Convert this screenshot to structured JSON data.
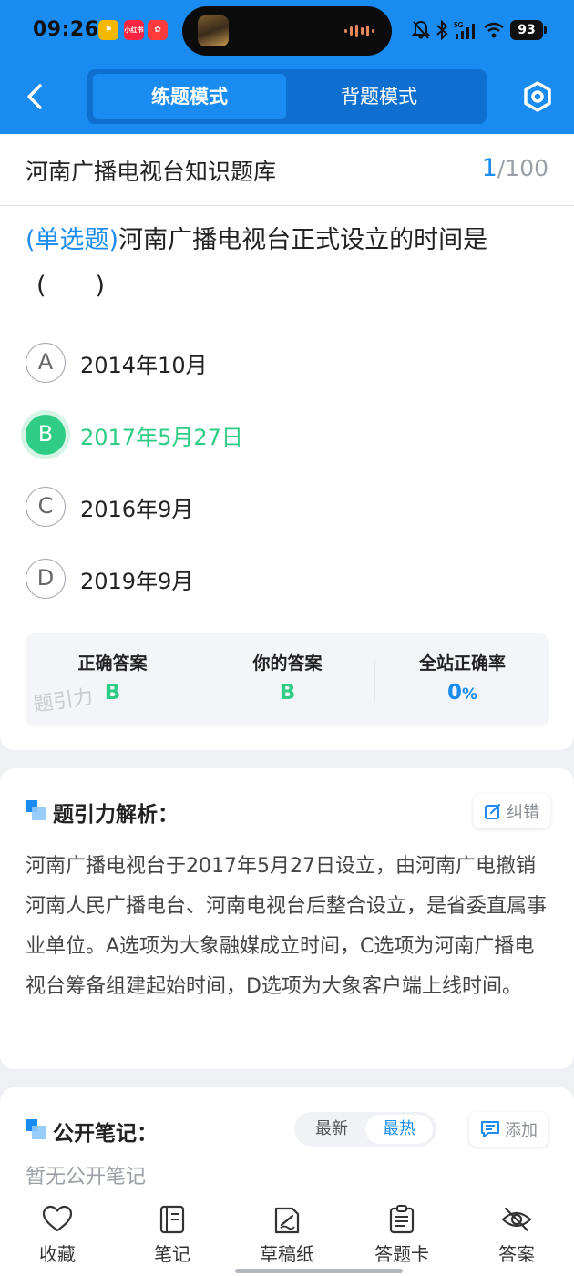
{
  "status_bar": {
    "time": "09:26",
    "battery": "93",
    "badges": [
      "小红书",
      "小"
    ]
  },
  "header": {
    "modes": [
      "练题模式",
      "背题模式"
    ],
    "active_mode": "练题模式"
  },
  "question_bank": {
    "title": "河南广播电视台知识题库",
    "current": "1",
    "total": "/100"
  },
  "question": {
    "type": "(单选题)",
    "text": "河南广播电视台正式设立的时间是",
    "blank": "(　　)",
    "options": [
      {
        "letter": "A",
        "text": "2014年10月"
      },
      {
        "letter": "B",
        "text": "2017年5月27日"
      },
      {
        "letter": "C",
        "text": "2016年9月"
      },
      {
        "letter": "D",
        "text": "2019年9月"
      }
    ],
    "selected": "B"
  },
  "stats": {
    "correct_label": "正确答案",
    "correct_value": "B",
    "yours_label": "你的答案",
    "yours_value": "B",
    "rate_label": "全站正确率",
    "rate_value": "0",
    "rate_unit": "%",
    "watermark": "题引力"
  },
  "analysis": {
    "title": "题引力解析：",
    "error_button": "纠错",
    "text": "河南广播电视台于2017年5月27日设立，由河南广电撤销河南人民广播电台、河南电视台后整合设立，是省委直属事业单位。A选项为大象融媒成立时间，C选项为河南广播电视台筹备组建起始时间，D选项为大象客户端上线时间。"
  },
  "notes": {
    "title": "公开笔记：",
    "sort_newest": "最新",
    "sort_hottest": "最热",
    "active_sort": "最热",
    "add_button": "添加",
    "empty_text": "暂无公开笔记"
  },
  "bottom_nav": [
    {
      "icon": "heart-icon",
      "label": "收藏"
    },
    {
      "icon": "notebook-icon",
      "label": "笔记"
    },
    {
      "icon": "draft-paper-icon",
      "label": "草稿纸"
    },
    {
      "icon": "answer-card-icon",
      "label": "答题卡"
    },
    {
      "icon": "eye-off-icon",
      "label": "答案"
    }
  ],
  "colors": {
    "primary": "#1a8bf0",
    "correct": "#2ecc84",
    "muted": "#9aa0a6"
  }
}
